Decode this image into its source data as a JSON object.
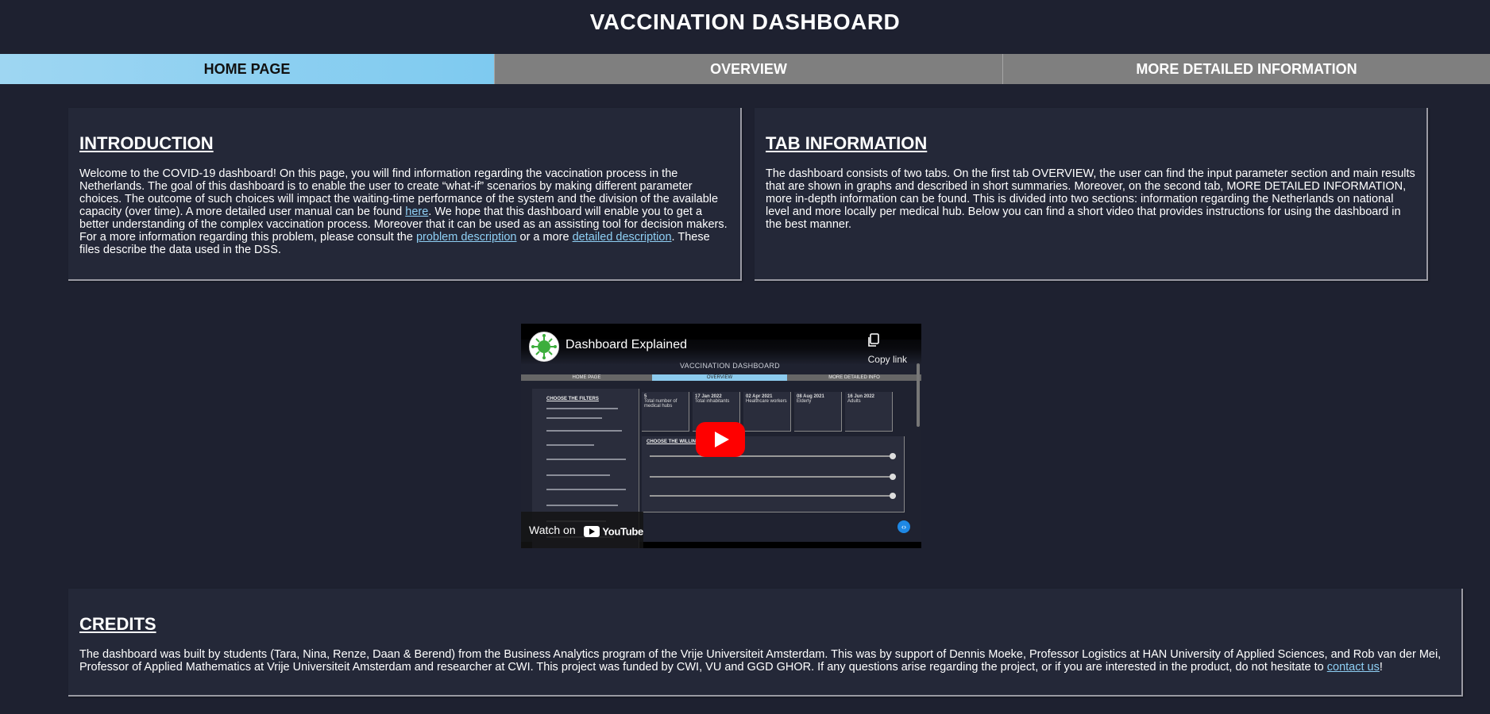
{
  "page": {
    "title": "VACCINATION DASHBOARD"
  },
  "tabs": [
    {
      "label": "HOME PAGE",
      "active": true
    },
    {
      "label": "OVERVIEW",
      "active": false
    },
    {
      "label": "MORE DETAILED INFORMATION",
      "active": false
    }
  ],
  "intro": {
    "heading": "INTRODUCTION",
    "text_1": "Welcome to the COVID-19 dashboard! On this page, you will find information regarding the vaccination process in the Netherlands. The goal of this dashboard is to enable the user to create “what-if” scenarios by making different parameter choices. The outcome of such choices will impact the waiting-time performance of the system and the division of the available capacity (over time). A more detailed user manual can be found ",
    "link_here": "here",
    "text_2": ". We hope that this dashboard will enable you to get a better understanding of the complex vaccination process. Moreover that it can be used as an assisting tool for decision makers. For a more information regarding this problem, please consult the ",
    "link_problem": "problem description",
    "text_3": " or a more ",
    "link_detailed": "detailed description",
    "text_4": ". These files describe the data used in the DSS."
  },
  "tab_info": {
    "heading": "TAB INFORMATION",
    "text": "The dashboard consists of two tabs. On the first tab OVERVIEW, the user can find the input parameter section and main results that are shown in graphs and described in short summaries. Moreover, on the second tab, MORE DETAILED INFORMATION, more in-depth information can be found. This is divided into two sections: information regarding the Netherlands on national level and more locally per medical hub. Below you can find a short video that provides instructions for using the dashboard in the best manner."
  },
  "video": {
    "title": "Dashboard Explained",
    "inner_title": "VACCINATION DASHBOARD",
    "copy_label": "Copy link",
    "watch_label": "Watch on",
    "youtube_label": "YouTube",
    "inner_tabs": [
      "HOME PAGE",
      "OVERVIEW",
      "MORE DETAILED INFO"
    ],
    "inner_boxes": [
      {
        "head": "5",
        "sub": "Total number of medical hubs"
      },
      {
        "head": "17 Jan 2022",
        "sub": "Total inhabitants"
      },
      {
        "head": "02 Apr 2021",
        "sub": "Healthcare workers"
      },
      {
        "head": "08 Aug 2021",
        "sub": "Elderly"
      },
      {
        "head": "16 Jun 2022",
        "sub": "Adults"
      }
    ],
    "inner_filter_heading": "CHOOSE THE FILTERS",
    "inner_panel_heading": "CHOOSE THE WILLINGNESS"
  },
  "credits": {
    "heading": "CREDITS",
    "text_1": "The dashboard was built by students (Tara, Nina, Renze, Daan & Berend) from the Business Analytics program of the Vrije Universiteit Amsterdam. This was by support of Dennis Moeke, Professor Logistics at HAN University of Applied Sciences, and Rob van der Mei, Professor of Applied Mathematics at Vrije Universiteit Amsterdam and researcher at CWI. This project was funded by CWI, VU and GGD GHOR. If any questions arise regarding the project, or if you are interested in the product, do not hesitate to ",
    "link_contact": "contact us",
    "text_2": "!"
  },
  "colors": {
    "background": "#1e2130",
    "card": "#242838",
    "tab_active": "#87ceeb",
    "tab_inactive": "#7f7f7f",
    "link": "#8fd0f5"
  }
}
